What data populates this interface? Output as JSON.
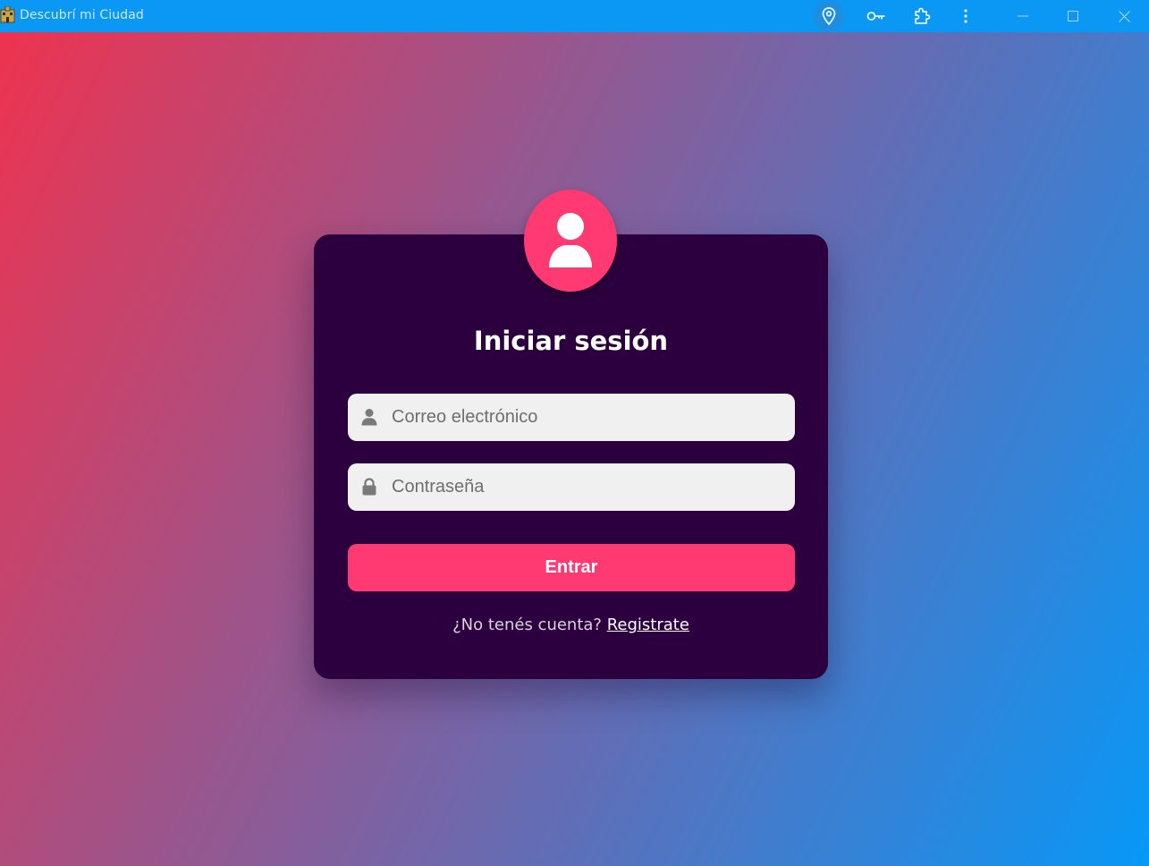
{
  "window": {
    "title": "Descubrí mi Ciudad",
    "toolbar_icons": [
      "location-pin-icon",
      "key-icon",
      "puzzle-icon",
      "more-vertical-icon"
    ],
    "controls": [
      "minimize",
      "maximize",
      "close"
    ],
    "titlebar_color": "#0b98f5"
  },
  "login": {
    "title": "Iniciar sesión",
    "avatar_icon": "user-icon",
    "email": {
      "placeholder": "Correo electrónico",
      "value": "",
      "icon": "user-icon"
    },
    "password": {
      "placeholder": "Contraseña",
      "value": "",
      "icon": "lock-icon"
    },
    "submit_label": "Entrar",
    "register_prompt": "¿No tenés cuenta?",
    "register_link": "Registrate"
  },
  "colors": {
    "accent": "#ff3a72",
    "card": "#2c003e",
    "gradient_start": "#ee3350",
    "gradient_end": "#0798f7"
  }
}
